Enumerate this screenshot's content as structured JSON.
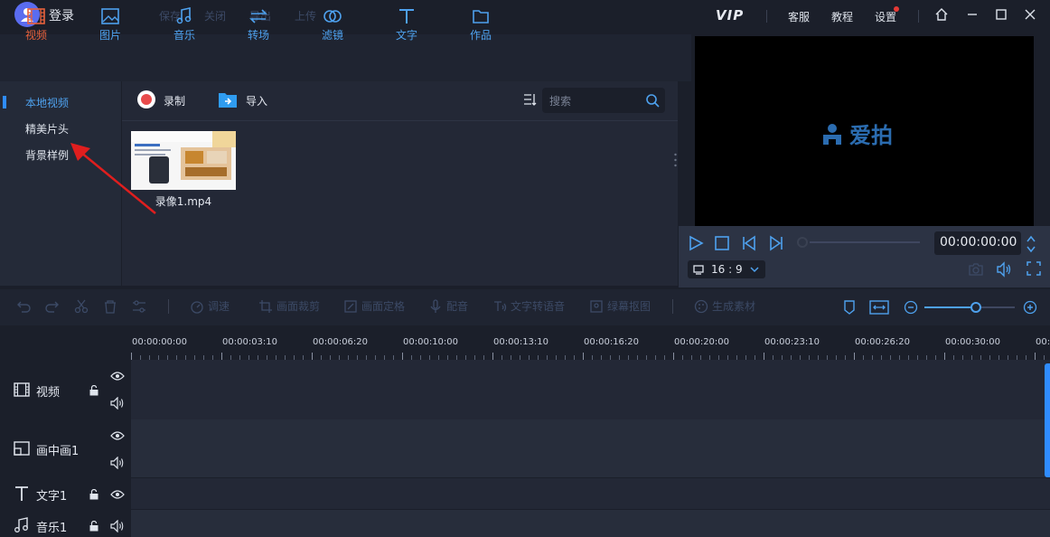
{
  "titlebar": {
    "login": "登录",
    "menu": [
      "保存",
      "关闭",
      "导出",
      "上传"
    ],
    "vip": "VIP",
    "service": "客服",
    "tutorial": "教程",
    "settings": "设置"
  },
  "media_tabs": [
    {
      "label": "视频",
      "icon": "film-icon",
      "active": true
    },
    {
      "label": "图片",
      "icon": "image-icon"
    },
    {
      "label": "音乐",
      "icon": "music-icon"
    },
    {
      "label": "转场",
      "icon": "transition-icon"
    },
    {
      "label": "滤镜",
      "icon": "filter-icon"
    },
    {
      "label": "文字",
      "icon": "text-icon"
    },
    {
      "label": "作品",
      "icon": "folder-icon"
    }
  ],
  "categories": [
    "本地视频",
    "精美片头",
    "背景样例"
  ],
  "media_toolbar": {
    "record": "录制",
    "import": "导入",
    "search_placeholder": "搜索"
  },
  "media_items": [
    {
      "name": "录像1.mp4"
    }
  ],
  "preview": {
    "brand": "爱拍",
    "time": "00:00:00:00",
    "ratio": "16 : 9"
  },
  "edit_tools": [
    "调速",
    "画面裁剪",
    "画面定格",
    "配音",
    "文字转语音",
    "绿幕抠图",
    "生成素材"
  ],
  "timeline": {
    "ticks": [
      "00:00:00:00",
      "00:00:03:10",
      "00:00:06:20",
      "00:00:10:00",
      "00:00:13:10",
      "00:00:16:20",
      "00:00:20:00",
      "00:00:23:10",
      "00:00:26:20",
      "00:00:30:00",
      "00:0"
    ],
    "tracks": [
      "视频",
      "画中画1",
      "文字1",
      "音乐1"
    ]
  },
  "colors": {
    "accent": "#4ea1ee",
    "active_tab": "#e8613c",
    "record": "#e84b4b",
    "bg": "#1b1f2a"
  }
}
